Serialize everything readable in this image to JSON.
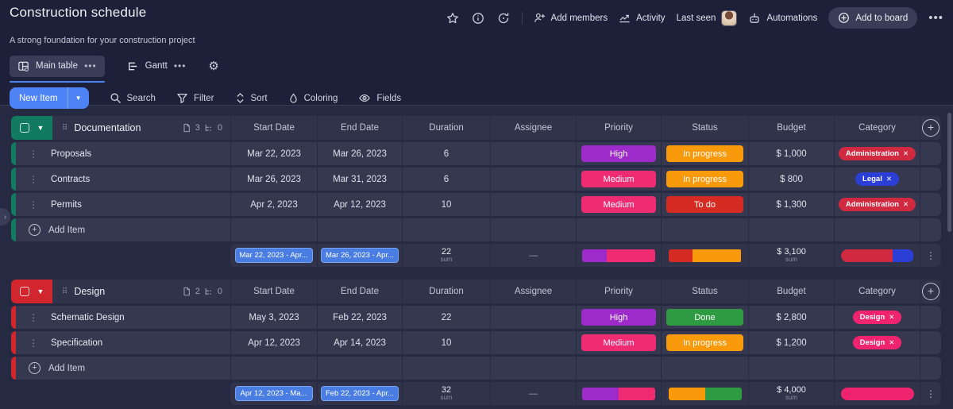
{
  "header": {
    "title": "Construction schedule",
    "subtitle": "A strong foundation for your construction project",
    "tabs": [
      {
        "label": "Main table"
      },
      {
        "label": "Gantt"
      }
    ],
    "actions": {
      "add_members": "Add members",
      "activity": "Activity",
      "last_seen": "Last seen",
      "automations": "Automations",
      "add_to_board": "Add to board"
    }
  },
  "toolbar": {
    "new_item": "New Item",
    "search": "Search",
    "filter": "Filter",
    "sort": "Sort",
    "coloring": "Coloring",
    "fields": "Fields"
  },
  "columns": [
    "Start Date",
    "End Date",
    "Duration",
    "Assignee",
    "Priority",
    "Status",
    "Budget",
    "Category"
  ],
  "misc": {
    "close": "✕",
    "dash": "—",
    "add_item": "Add Item"
  },
  "colors": {
    "accent": "#4e83f5",
    "group1": "#127a61",
    "group2": "#d2262e"
  },
  "groups": [
    {
      "name": "Documentation",
      "color": "#127a61",
      "item_count": "3",
      "subitem_count": "0",
      "items": [
        {
          "name": "Proposals",
          "start": "Mar 22, 2023",
          "end": "Mar 26, 2023",
          "duration": "6",
          "priority": {
            "label": "High",
            "color": "#9c2bca"
          },
          "status": {
            "label": "In progress",
            "color": "#f99a0d"
          },
          "budget": "$ 1,000",
          "category": {
            "label": "Administration",
            "color": "#d02940"
          }
        },
        {
          "name": "Contracts",
          "start": "Mar 26, 2023",
          "end": "Mar 31, 2023",
          "duration": "6",
          "priority": {
            "label": "Medium",
            "color": "#ef2b72"
          },
          "status": {
            "label": "In progress",
            "color": "#f99a0d"
          },
          "budget": "$ 800",
          "category": {
            "label": "Legal",
            "color": "#2b3fd6"
          }
        },
        {
          "name": "Permits",
          "start": "Apr 2, 2023",
          "end": "Apr 12, 2023",
          "duration": "10",
          "priority": {
            "label": "Medium",
            "color": "#ef2b72"
          },
          "status": {
            "label": "To do",
            "color": "#d62b23"
          },
          "budget": "$ 1,300",
          "category": {
            "label": "Administration",
            "color": "#d02940"
          }
        }
      ],
      "summary": {
        "start_range": "Mar 22, 2023 - Apr...",
        "end_range": "Mar 26, 2023 - Apr...",
        "duration_sum": "22",
        "sum_label": "sum",
        "budget_sum": "$ 3,100",
        "priority_bar": [
          {
            "color": "#9c2bca",
            "width": "33.3%"
          },
          {
            "color": "#ef2b72",
            "width": "66.7%"
          }
        ],
        "status_bar": [
          {
            "color": "#d62b23",
            "width": "33.3%"
          },
          {
            "color": "#f99a0d",
            "width": "66.7%"
          }
        ],
        "category_bar": [
          {
            "color": "#d02940",
            "width": "71%"
          },
          {
            "color": "#2b3fd6",
            "width": "29%"
          }
        ]
      }
    },
    {
      "name": "Design",
      "color": "#d2262e",
      "item_count": "2",
      "subitem_count": "0",
      "items": [
        {
          "name": "Schematic Design",
          "start": "May 3, 2023",
          "end": "Feb 22, 2023",
          "duration": "22",
          "priority": {
            "label": "High",
            "color": "#9c2bca"
          },
          "status": {
            "label": "Done",
            "color": "#2e9b43"
          },
          "budget": "$ 2,800",
          "category": {
            "label": "Design",
            "color": "#f0246e"
          }
        },
        {
          "name": "Specification",
          "start": "Apr 12, 2023",
          "end": "Apr 14, 2023",
          "duration": "10",
          "priority": {
            "label": "Medium",
            "color": "#ef2b72"
          },
          "status": {
            "label": "In progress",
            "color": "#f99a0d"
          },
          "budget": "$ 1,200",
          "category": {
            "label": "Design",
            "color": "#f0246e"
          }
        }
      ],
      "summary": {
        "start_range": "Apr 12, 2023 - Ma...",
        "end_range": "Feb 22, 2023 - Apr...",
        "duration_sum": "32",
        "sum_label": "sum",
        "budget_sum": "$ 4,000",
        "priority_bar": [
          {
            "color": "#9c2bca",
            "width": "50%"
          },
          {
            "color": "#ef2b72",
            "width": "50%"
          }
        ],
        "status_bar": [
          {
            "color": "#f99a0d",
            "width": "50%"
          },
          {
            "color": "#2e9b43",
            "width": "50%"
          }
        ],
        "category_bar": [
          {
            "color": "#f0246e",
            "width": "100%"
          }
        ]
      }
    }
  ]
}
